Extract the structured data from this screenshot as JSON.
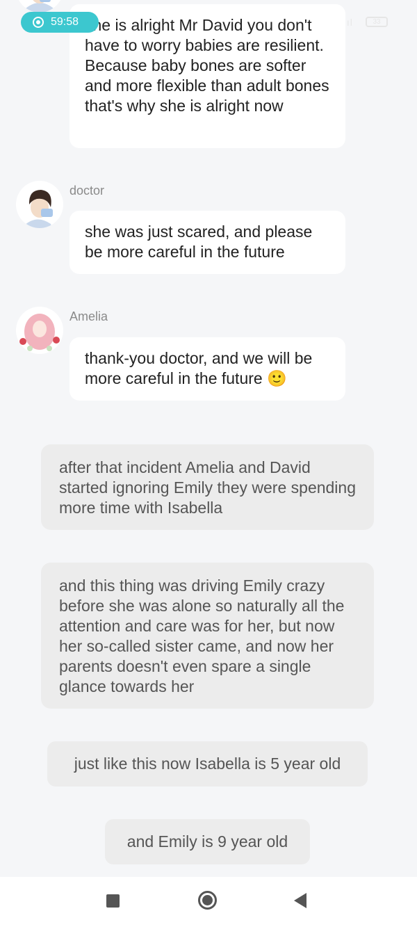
{
  "status_bar": {
    "recording_time": "59:58",
    "signal": "ııl",
    "battery": "33"
  },
  "messages": [
    {
      "speaker": "",
      "text": "she is alright Mr David you don't have to worry babies are resilient. Because baby bones are softer and more flexible than adult bones that's why she is alright now"
    },
    {
      "speaker": "doctor",
      "text": "she was just scared, and please be more careful in the future"
    },
    {
      "speaker": "Amelia",
      "text": "thank-you doctor, and we will be more careful in the future 🙂"
    }
  ],
  "narrations": [
    "after that incident Amelia and David started ignoring Emily they were spending more time with Isabella",
    "and this thing was driving Emily crazy before she was alone so naturally all the attention and care was for her, but now her so-called sister came, and now her parents doesn't even spare a single glance towards her",
    "just like this now Isabella is 5 year old",
    "and Emily is 9 year old"
  ],
  "icons": {
    "nav_recents": "square-icon",
    "nav_home": "circle-icon",
    "nav_back": "triangle-back-icon"
  }
}
